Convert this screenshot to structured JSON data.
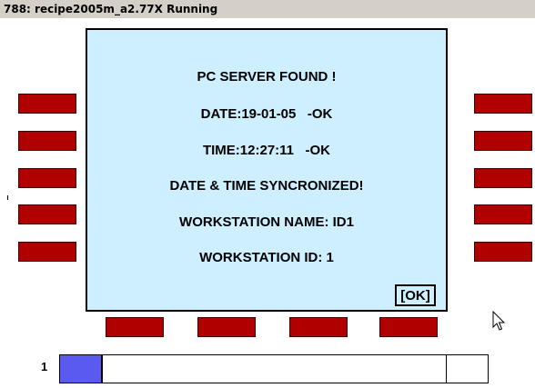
{
  "window": {
    "title": "788: recipe2005m_a2.77X Running"
  },
  "dialog": {
    "lines": [
      "PC SERVER FOUND !",
      "DATE:19-01-05   -OK",
      "TIME:12:27:11   -OK",
      "DATE & TIME SYNCRONIZED!",
      "WORKSTATION NAME: ID1",
      "WORKSTATION ID: 1"
    ],
    "ok_label": "[OK]"
  },
  "softkeys": {
    "color": "#b10000"
  },
  "status": {
    "page_number": "1",
    "progress_fraction": 0.1,
    "progress_color": "#5a5af0"
  },
  "icons": {
    "cursor": "mouse-pointer-icon"
  }
}
